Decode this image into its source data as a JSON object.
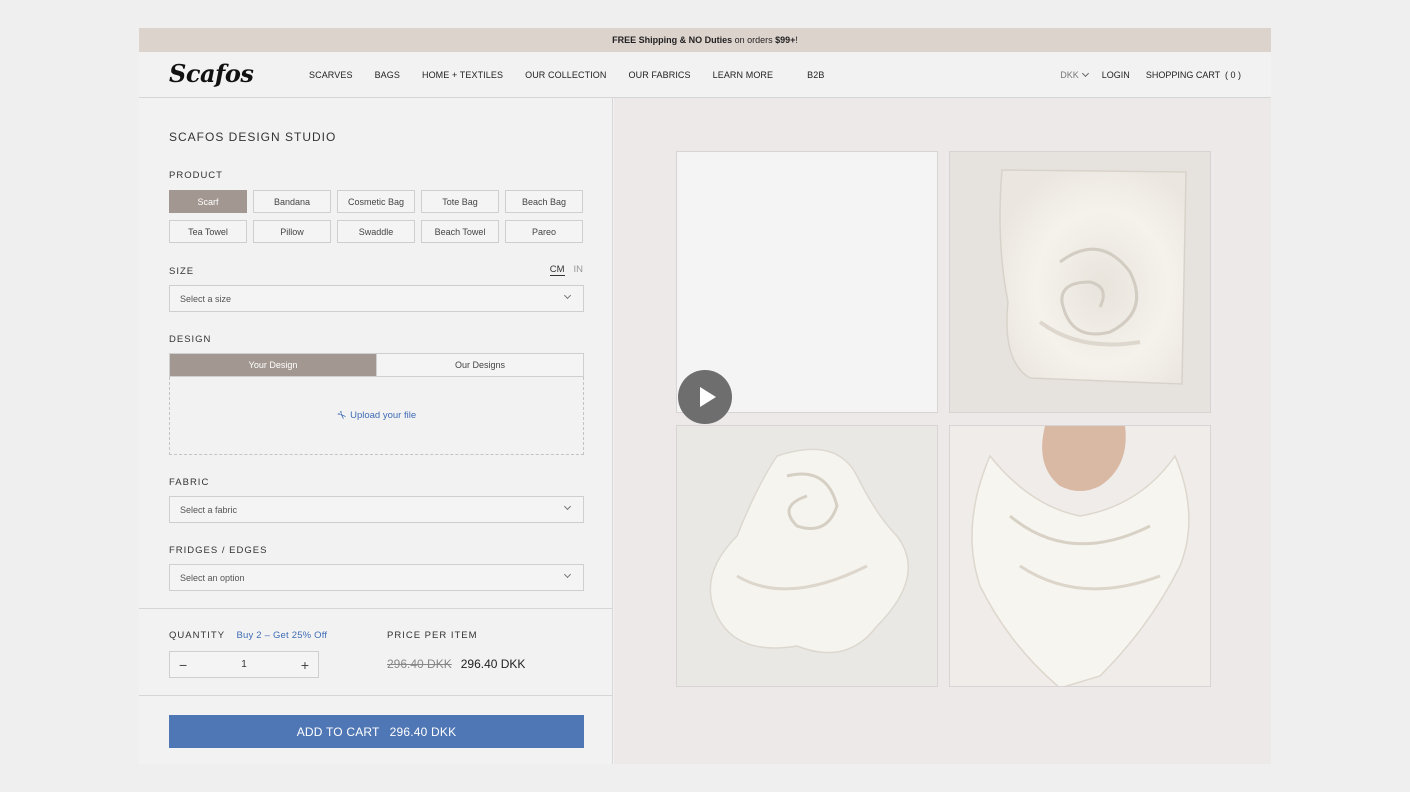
{
  "announcement": {
    "bold": "FREE Shipping & NO Duties",
    "mid": " on orders ",
    "amount": "$99+",
    "end": "!"
  },
  "header": {
    "logo": "Scafos",
    "nav": [
      "SCARVES",
      "BAGS",
      "HOME + TEXTILES",
      "OUR COLLECTION",
      "OUR FABRICS",
      "LEARN MORE",
      "B2B"
    ],
    "currency": "DKK",
    "login": "LOGIN",
    "cart": "SHOPPING CART  ( 0 )"
  },
  "studio": {
    "title": "SCAFOS DESIGN STUDIO",
    "product_label": "PRODUCT",
    "products": [
      "Scarf",
      "Bandana",
      "Cosmetic Bag",
      "Tote Bag",
      "Beach Bag",
      "Tea Towel",
      "Pillow",
      "Swaddle",
      "Beach Towel",
      "Pareo"
    ],
    "selected_product": "Scarf",
    "size_label": "SIZE",
    "unit_cm": "CM",
    "unit_in": "IN",
    "size_placeholder": "Select a size",
    "design_label": "DESIGN",
    "tab_your": "Your Design",
    "tab_our": "Our Designs",
    "upload": "Upload your file",
    "fabric_label": "FABRIC",
    "fabric_placeholder": "Select a fabric",
    "edges_label": "FRIDGES / EDGES",
    "edges_placeholder": "Select an option",
    "quantity_label": "QUANTITY",
    "quantity_promo": "Buy 2 – Get 25% Off",
    "quantity": "1",
    "minus": "−",
    "plus": "+",
    "price_label": "PRICE PER ITEM",
    "old_price": "296.40 DKK",
    "new_price": "296.40 DKK",
    "cart_button": "ADD TO CART",
    "cart_total": "296.40 DKK"
  },
  "colors": {
    "accent_blue": "#5077b5",
    "selected_taupe": "#a39891",
    "announcement_bg": "#ddd3cd"
  }
}
